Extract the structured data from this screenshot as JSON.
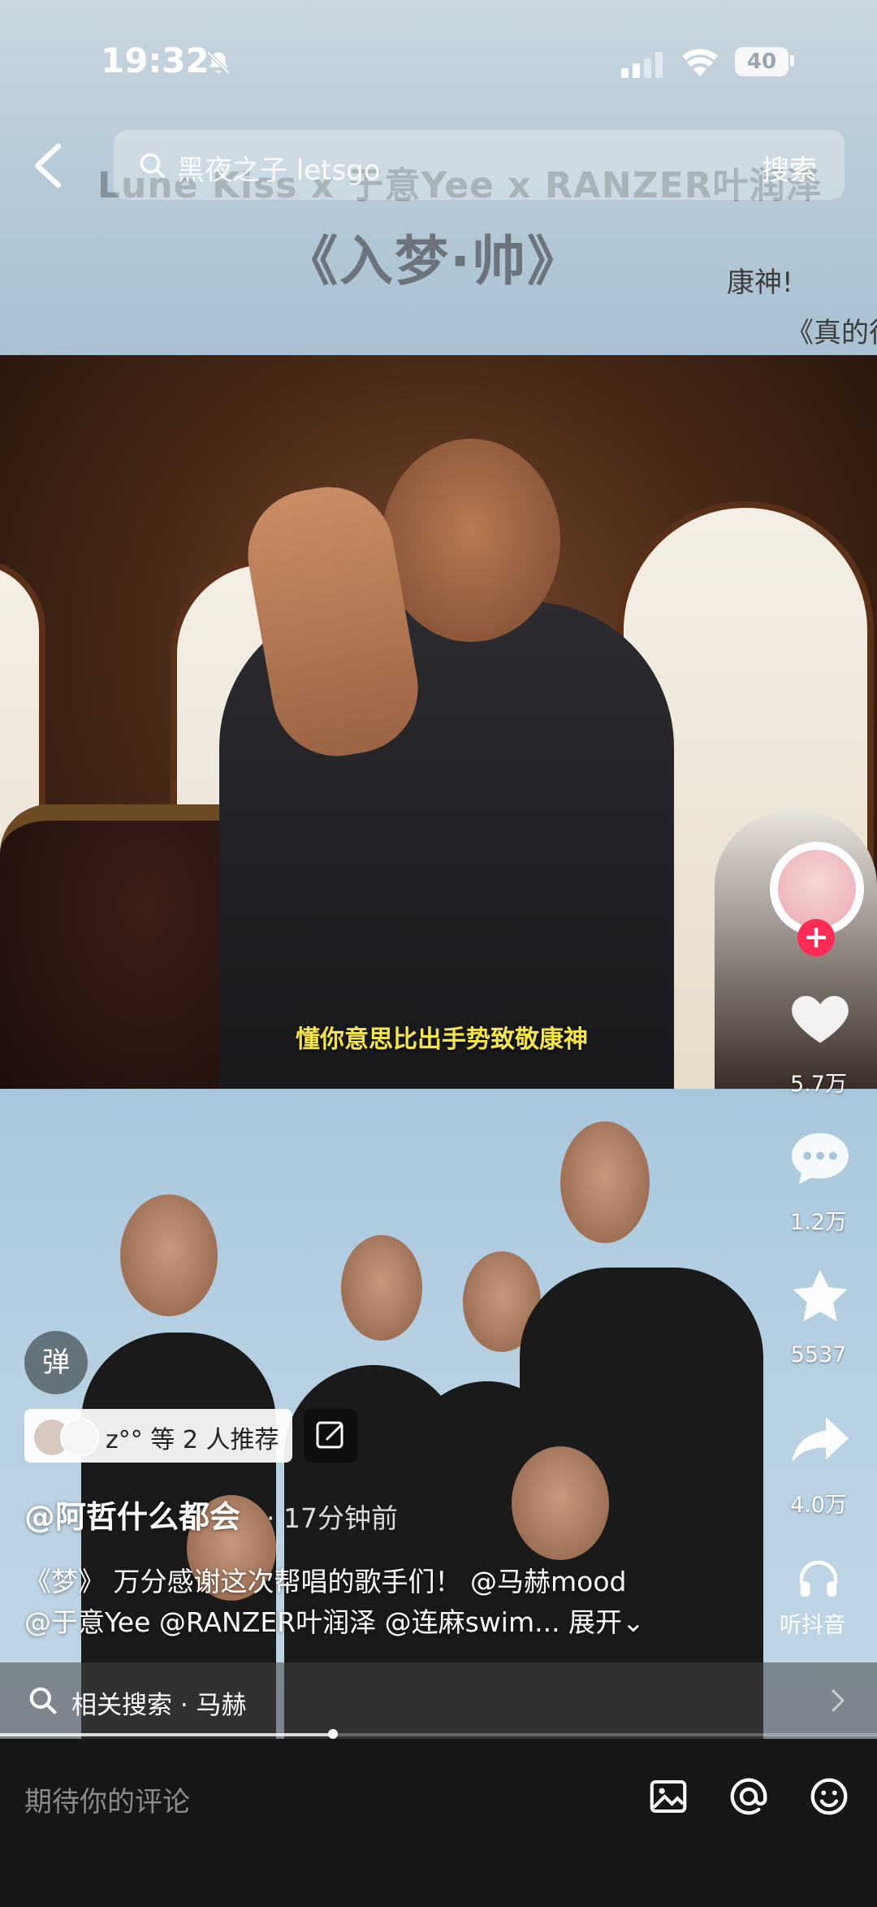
{
  "status_bar": {
    "time": "19:32",
    "battery": "40"
  },
  "search": {
    "query": "黑夜之子 letsgo",
    "button_label": "搜索"
  },
  "banner": {
    "credits": "Lune Kiss x 于意Yee x RANZER叶润泽",
    "title": "《入梦·帅》",
    "comment_1": "康神!",
    "comment_2": "《真的很"
  },
  "video": {
    "subtitle": "懂你意思比出手势致敬康神",
    "progress_fraction": 0.38
  },
  "actions": {
    "likes": "5.7万",
    "comments": "1.2万",
    "favorites": "5537",
    "shares": "4.0万",
    "listen_label": "听抖音"
  },
  "danmaku_label": "弹",
  "recommend": {
    "text": "z°° 等 2 人推荐"
  },
  "post": {
    "author": "@阿哲什么都会",
    "time": "· 17分钟前",
    "desc_line1": "《梦》 万分感谢这次帮唱的歌手们！ @马赫mood",
    "desc_line2": "@于意Yee @RANZER叶润泽 @连麻swim... 展开⌄"
  },
  "related": {
    "text": "相关搜索 · 马赫"
  },
  "comment_box": {
    "placeholder": "期待你的评论"
  },
  "colors": {
    "accent": "#fe2c55",
    "subtitle": "#f2e44a"
  }
}
